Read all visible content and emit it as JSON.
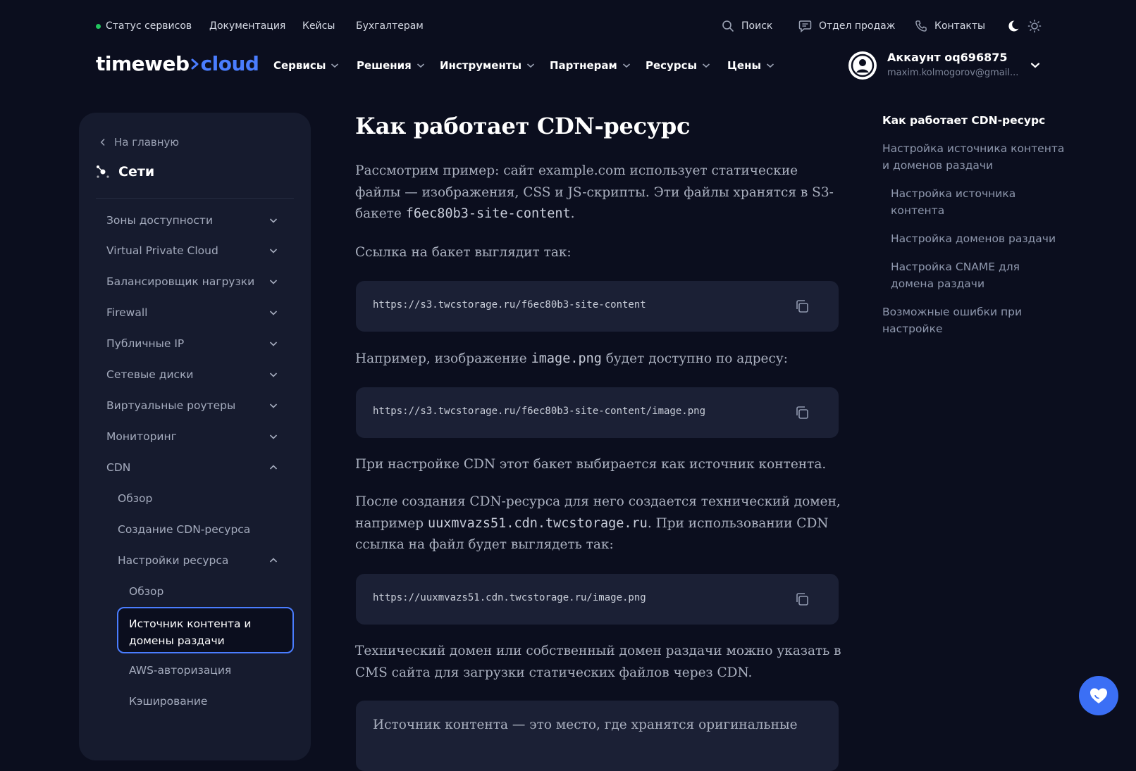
{
  "topbar": {
    "status": "Статус сервисов",
    "status_color": "#22c55e",
    "docs": "Документация",
    "cases": "Кейсы",
    "accountants": "Бухгалтерам",
    "search": "Поиск",
    "sales": "Отдел продаж",
    "contacts": "Контакты"
  },
  "brand": {
    "part1": "timeweb",
    "part2": "cloud",
    "accent": "#4a7dff"
  },
  "nav": {
    "services": "Сервисы",
    "solutions": "Решения",
    "tools": "Инструменты",
    "partners": "Партнерам",
    "resources": "Ресурсы",
    "prices": "Цены"
  },
  "account": {
    "name": "Аккаунт oq696875",
    "email": "maxim.kolmogorov@gmail..."
  },
  "sidebar": {
    "back": "На главную",
    "title": "Сети",
    "items": [
      "Зоны доступности",
      "Virtual Private Cloud",
      "Балансировщик нагрузки",
      "Firewall",
      "Публичные IP",
      "Сетевые диски",
      "Виртуальные роутеры",
      "Мониторинг",
      "CDN"
    ],
    "cdn": {
      "overview": "Обзор",
      "create": "Создание CDN-ресурса",
      "settings": "Настройки ресурса",
      "settings_children": {
        "overview": "Обзор",
        "origin_domains": "Источник контента и домены раздачи",
        "aws_auth": "AWS-авторизация",
        "caching": "Кэширование"
      }
    }
  },
  "content": {
    "title": "Как работает CDN-ресурс",
    "p1_a": "Рассмотрим пример: сайт example.com использует статические файлы — изображения, CSS и JS-скрипты. Эти файлы хранятся в S3-бакете ",
    "p1_code": "f6ec80b3-site-content",
    "p1_b": ".",
    "p2": "Ссылка на бакет выглядит так:",
    "code1": "https://s3.twcstorage.ru/f6ec80b3-site-content",
    "p3_a": "Например, изображение ",
    "p3_code": "image.png",
    "p3_b": " будет доступно по адресу:",
    "code2": "https://s3.twcstorage.ru/f6ec80b3-site-content/image.png",
    "p4": "При настройке CDN этот бакет выбирается как источник контента.",
    "p5_a": "После создания CDN-ресурса для него создается технический домен, например ",
    "p5_code": "uuxmvazs51.cdn.twcstorage.ru",
    "p5_b": ". При использовании CDN ссылка на файл будет выглядеть так:",
    "code3": "https://uuxmvazs51.cdn.twcstorage.ru/image.png",
    "p6": "Технический домен или собственный домен раздачи можно указать в CMS сайта для загрузки статических файлов через CDN.",
    "note": "Источник контента — это место, где хранятся оригинальные"
  },
  "toc": {
    "t1": "Как работает CDN-ресурс",
    "t2": "Настройка источника контента и доменов раздачи",
    "t3": "Настройка источника контента",
    "t4": "Настройка доменов раздачи",
    "t5": "Настройка CNAME для домена раздачи",
    "t6": "Возможные ошибки при настройке"
  },
  "icons": [
    "search-icon",
    "chat-icon",
    "phone-icon",
    "moon-icon",
    "sun-icon",
    "chevron-down-icon",
    "user-icon",
    "chevron-left-icon",
    "network-icon",
    "copy-icon",
    "heart-icon"
  ]
}
